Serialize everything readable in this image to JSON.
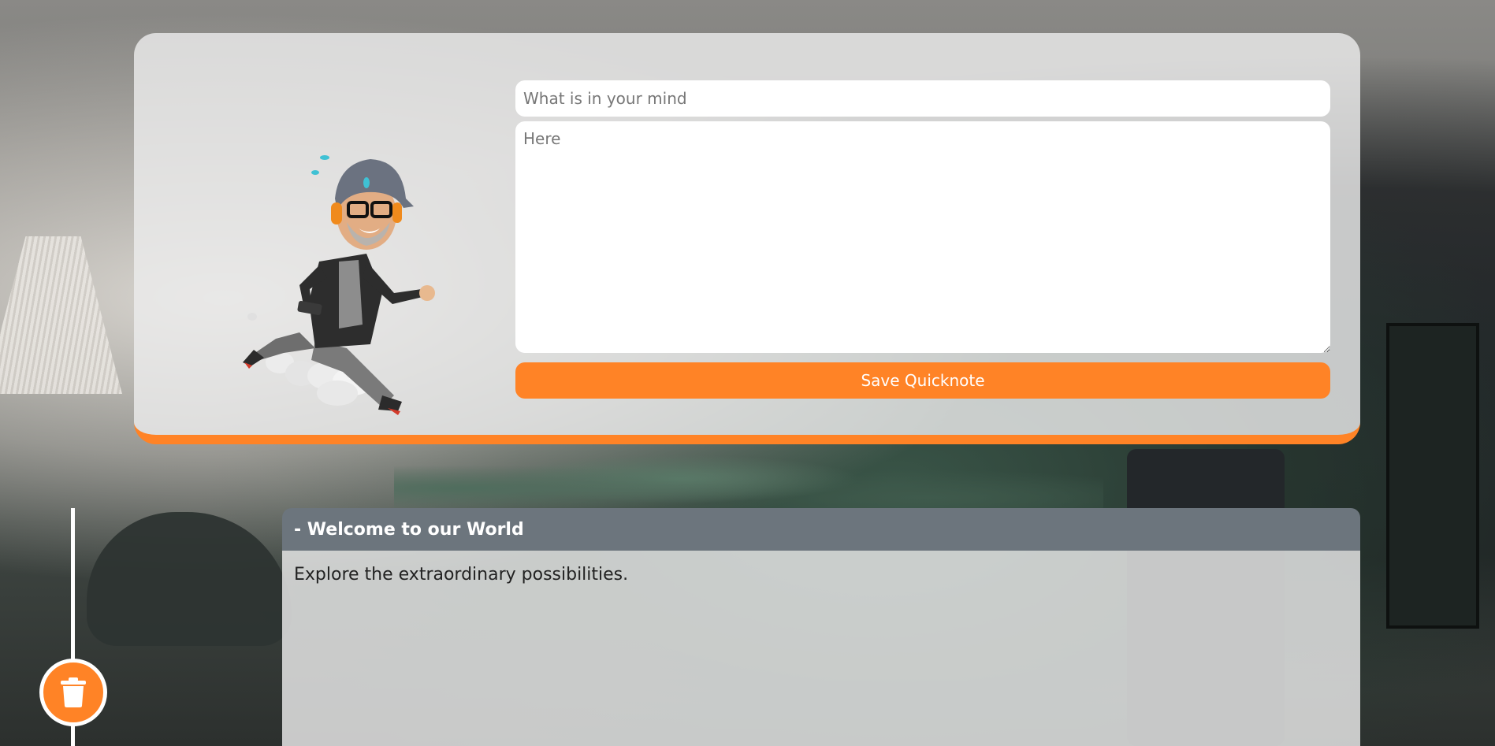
{
  "composer": {
    "title_placeholder": "What is in your mind",
    "body_placeholder": "Here",
    "save_label": "Save Quicknote"
  },
  "notes": [
    {
      "title": "- Welcome to our World",
      "body": "Explore the extraordinary possibilities."
    }
  ],
  "icons": {
    "delete": "trash-icon",
    "avatar": "running-avatar"
  },
  "colors": {
    "accent": "#ff8326",
    "note_header": "#6c757d",
    "card_bg": "#ececec"
  }
}
